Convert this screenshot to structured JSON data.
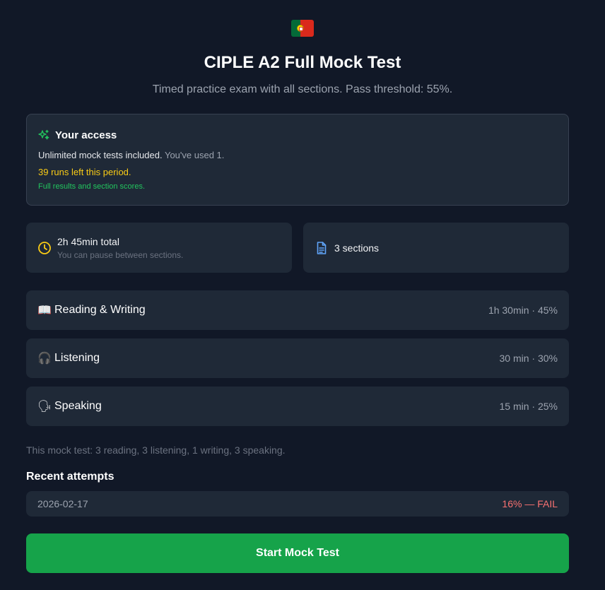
{
  "header": {
    "flag": "portugal-flag",
    "title": "CIPLE A2 Full Mock Test",
    "subtitle": "Timed practice exam with all sections. Pass threshold: 55%."
  },
  "access": {
    "icon": "sparkles-icon",
    "title": "Your access",
    "line1_strong": "Unlimited mock tests included.",
    "line1_muted": "You've used 1.",
    "runs_left": "39 runs left this period.",
    "results_note": "Full results and section scores."
  },
  "stats": {
    "duration": {
      "icon": "clock-icon",
      "label": "2h 45min total",
      "sub": "You can pause between sections."
    },
    "sections": {
      "icon": "document-icon",
      "label": "3 sections"
    }
  },
  "sections": [
    {
      "emoji": "📖",
      "icon": "book-icon",
      "name": "Reading & Writing",
      "meta": "1h 30min · 45%"
    },
    {
      "emoji": "🎧",
      "icon": "headphones-icon",
      "name": "Listening",
      "meta": "30 min · 30%"
    },
    {
      "emoji": "🗣",
      "icon": "speaking-head-icon",
      "name": "Speaking",
      "meta": "15 min · 25%"
    }
  ],
  "note": "This mock test: 3 reading, 3 listening, 1 writing, 3 speaking.",
  "recent": {
    "title": "Recent attempts",
    "attempts": [
      {
        "date": "2026-02-17",
        "result": "16% — FAIL"
      }
    ]
  },
  "actions": {
    "start_label": "Start Mock Test"
  },
  "colors": {
    "background": "#111827",
    "card": "#1f2937",
    "accent_green": "#16a34a",
    "warning_yellow": "#facc15",
    "fail_red": "#f87171"
  }
}
